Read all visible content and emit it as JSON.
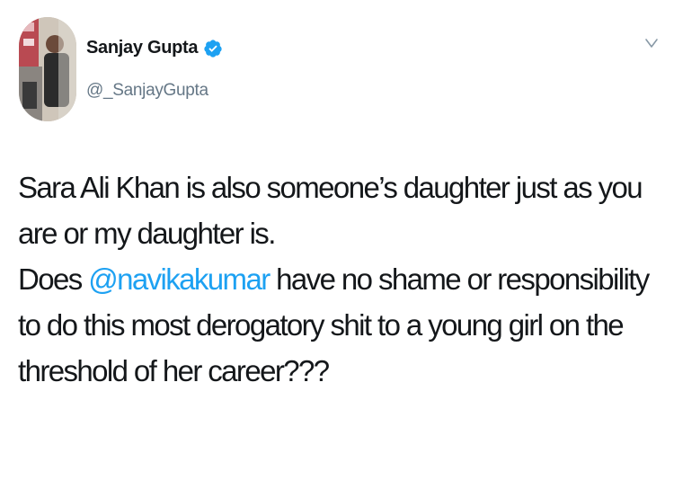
{
  "author": {
    "display_name": "Sanjay Gupta",
    "handle": "@_SanjayGupta",
    "verified": true
  },
  "colors": {
    "text": "#14171a",
    "secondary": "#657786",
    "accent": "#1da1f2"
  },
  "icons": {
    "verified": "verified-badge-icon",
    "menu": "chevron-down-icon"
  },
  "tweet": {
    "line1": "Sara Ali Khan is also someone’s daughter just as you are or my daughter is.",
    "line2_before": "Does ",
    "mention": "@navikakumar",
    "line2_after": " have no shame or responsibility to do this most derogatory shit to a young girl on the threshold of her career???"
  }
}
